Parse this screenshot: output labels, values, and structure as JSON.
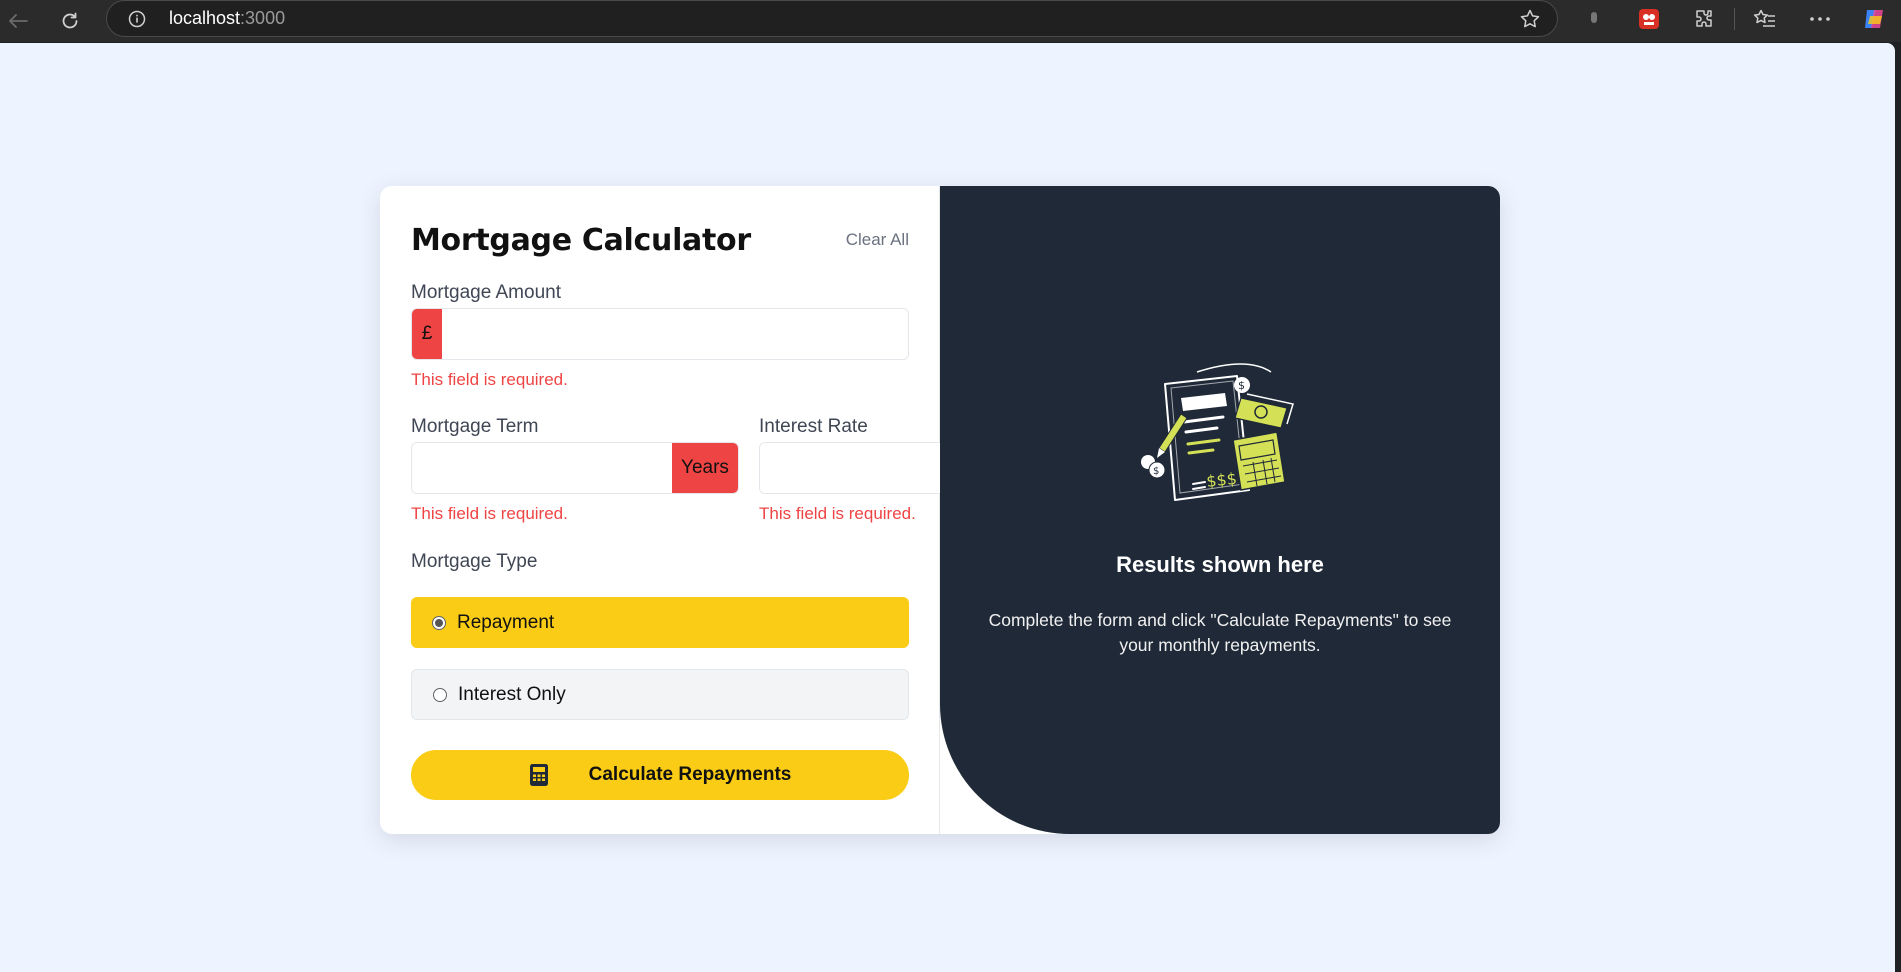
{
  "browser": {
    "url_host": "localhost",
    "url_port": ":3000"
  },
  "calculator": {
    "title": "Mortgage Calculator",
    "clear_label": "Clear All",
    "amount": {
      "label": "Mortgage Amount",
      "currency_symbol": "£",
      "value": "",
      "error": "This field is required."
    },
    "term": {
      "label": "Mortgage Term",
      "unit": "Years",
      "value": "",
      "error": "This field is required."
    },
    "rate": {
      "label": "Interest Rate",
      "unit": "%",
      "value": "",
      "error": "This field is required."
    },
    "type": {
      "label": "Mortgage Type",
      "options": [
        {
          "label": "Repayment",
          "selected": true
        },
        {
          "label": "Interest Only",
          "selected": false
        }
      ]
    },
    "submit_label": "Calculate Repayments"
  },
  "results": {
    "title": "Results shown here",
    "description": "Complete the form and click \"Calculate Repayments\" to see your monthly repayments.",
    "illustration_icon": "empty-results-illustration"
  },
  "colors": {
    "accent": "#facc15",
    "error": "#ef4444",
    "panel": "#1f2937",
    "page_bg": "#eef4ff"
  }
}
